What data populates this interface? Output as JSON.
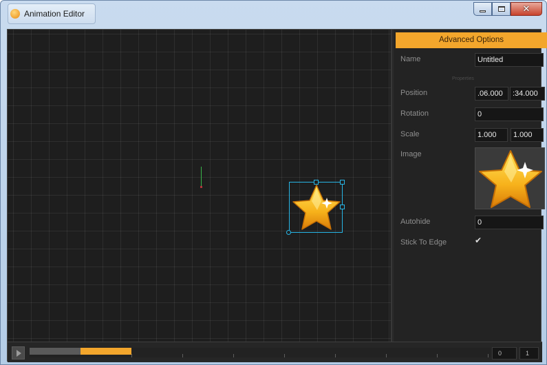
{
  "window": {
    "title": "Animation Editor",
    "close_glyph": "✕"
  },
  "panel": {
    "header": "Advanced Options",
    "section_label": "Properties",
    "name_label": "Name",
    "name_value": "Untitled",
    "position_label": "Position",
    "position_x": ".06.000",
    "position_y": ":34.000",
    "rotation_label": "Rotation",
    "rotation_value": "0",
    "scale_label": "Scale",
    "scale_x": "1.000",
    "scale_y": "1.000",
    "image_label": "Image",
    "autohide_label": "Autohide",
    "autohide_value": "0",
    "stick_label": "Stick To Edge",
    "stick_checked": "✔"
  },
  "timeline": {
    "current_frame": "0",
    "frame_count": "1"
  },
  "colors": {
    "accent": "#f3a62c",
    "selection": "#27b6e6",
    "origin_axis": "#3ab54a"
  },
  "icons": [
    "app-icon",
    "minimize-icon",
    "maximize-icon",
    "close-icon",
    "star-sprite",
    "play-icon"
  ]
}
